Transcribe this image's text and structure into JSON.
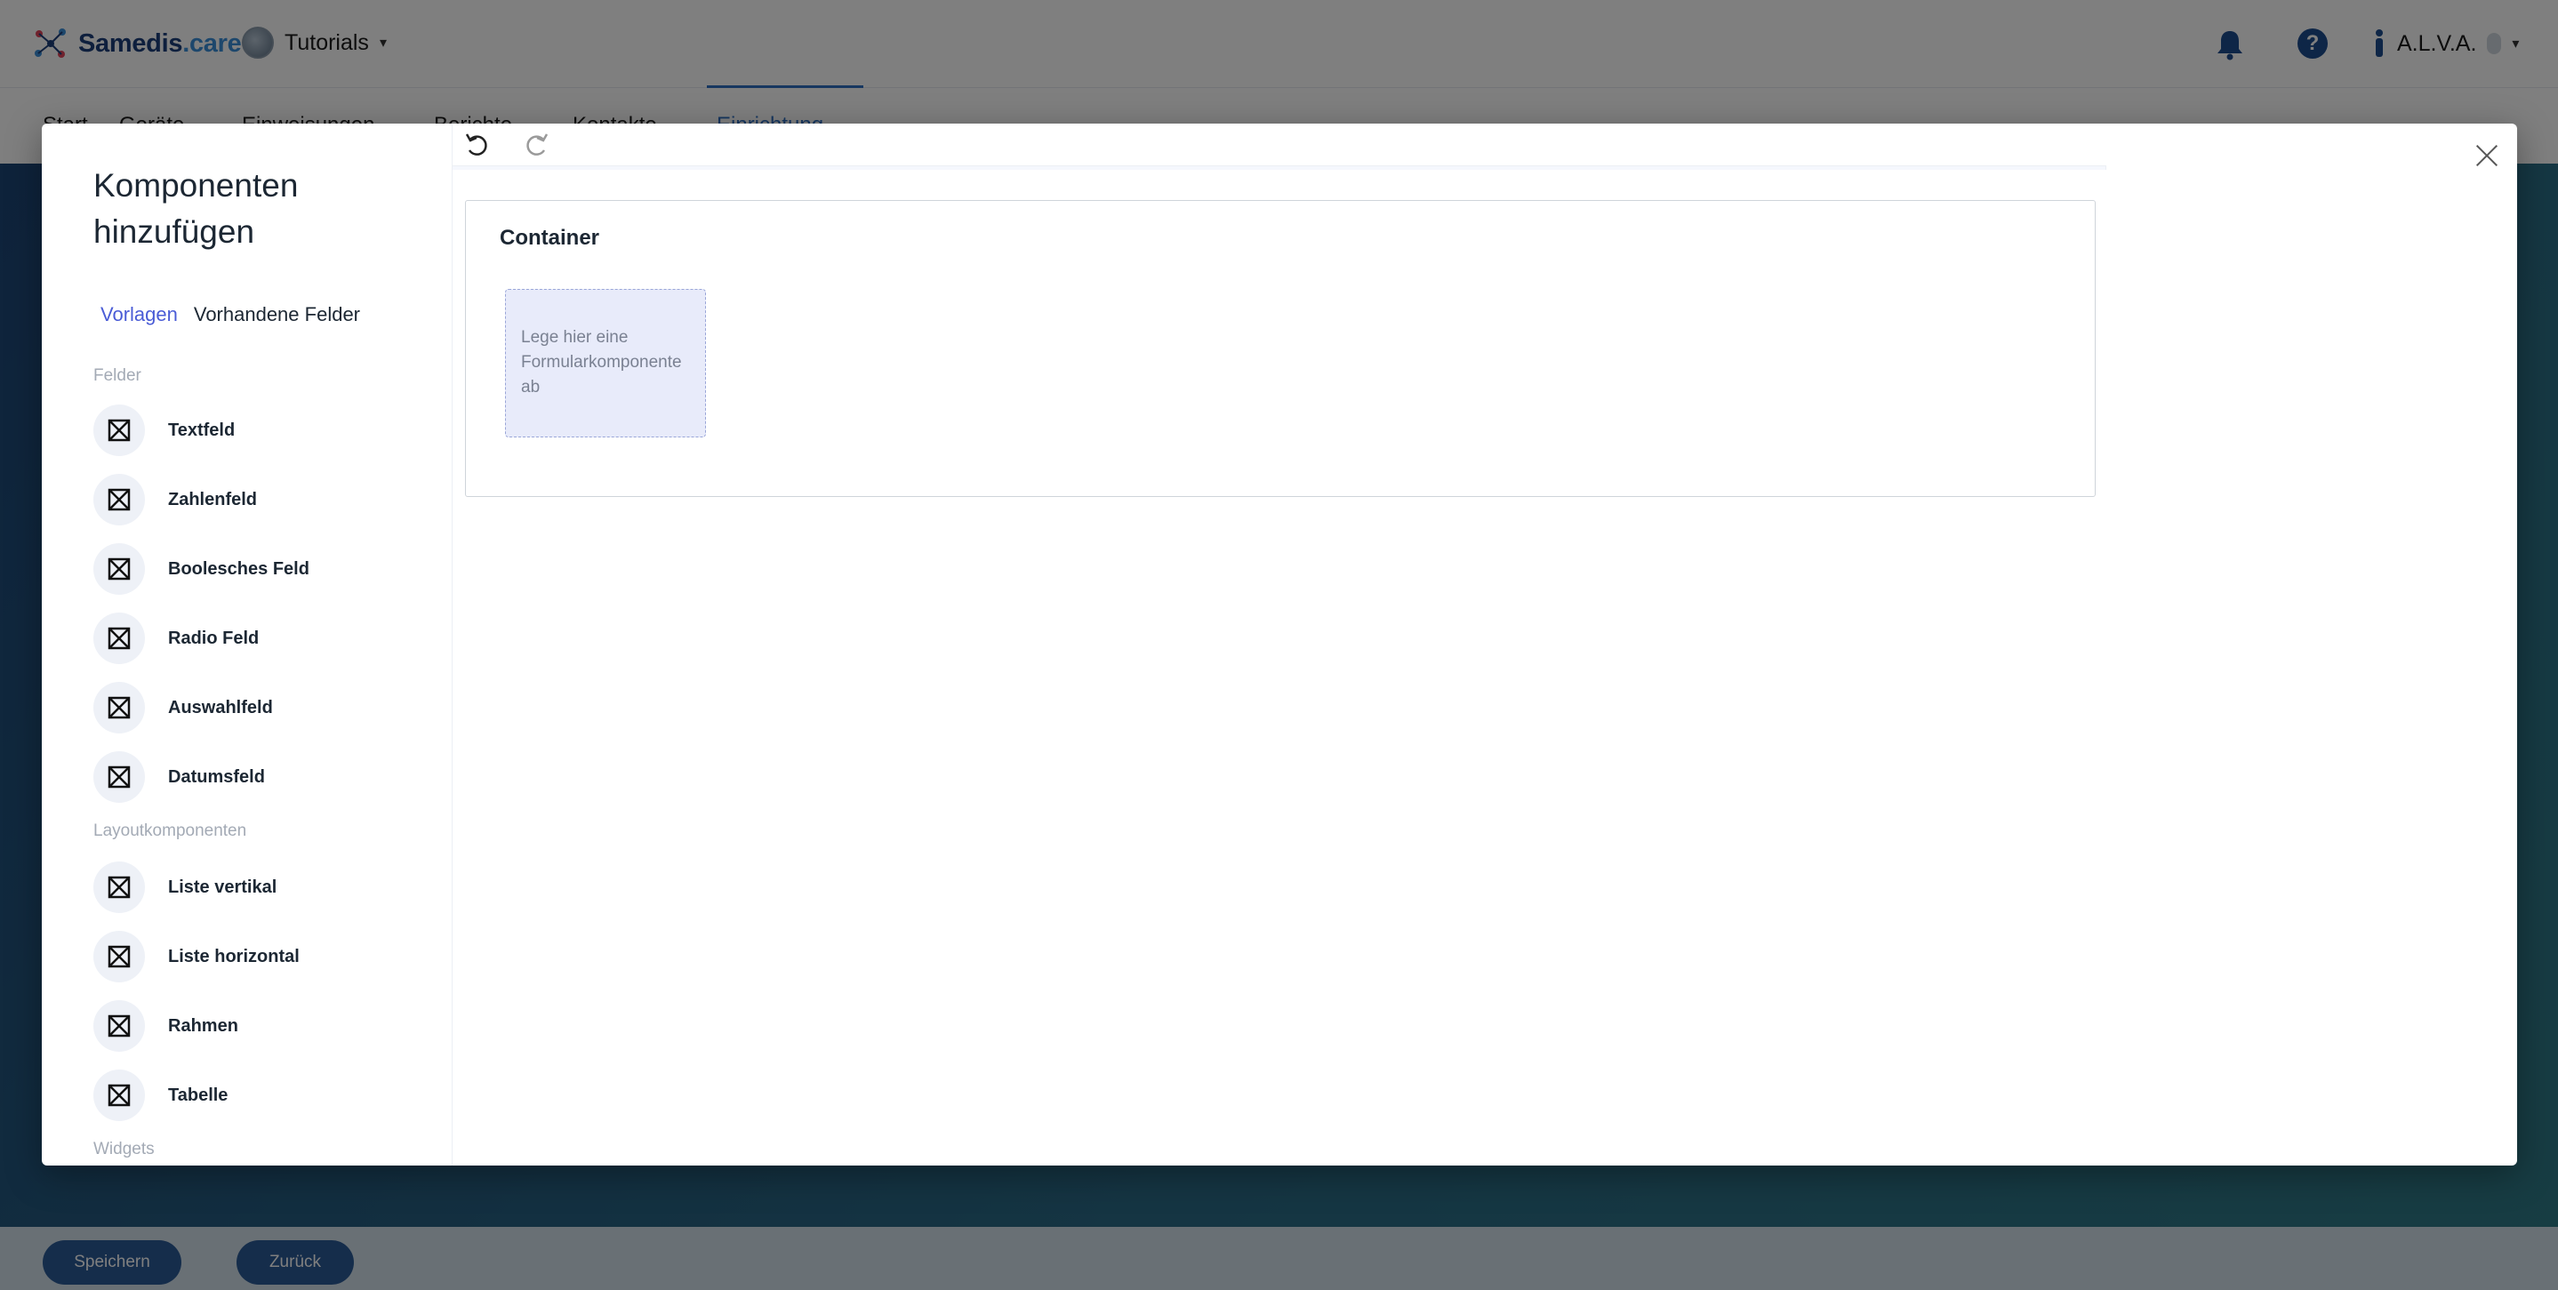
{
  "app": {
    "logo_main": "Samedis",
    "logo_suffix": ".care",
    "tenant": "Tutorials",
    "user": "A.L.V.A."
  },
  "nav_tabs": [
    "Start",
    "Geräte",
    "Einweisungen",
    "Berichte",
    "Kontakte",
    "Einrichtung"
  ],
  "footer": {
    "save_label": "Speichern",
    "back_label": "Zurück"
  },
  "modal": {
    "title": "Komponenten hinzufügen",
    "tabs": [
      "Vorlagen",
      "Vorhandene Felder"
    ],
    "groups": {
      "fields_label": "Felder",
      "fields": [
        "Textfeld",
        "Zahlenfeld",
        "Boolesches Feld",
        "Radio Feld",
        "Auswahlfeld",
        "Datumsfeld"
      ],
      "layout_label": "Layoutkomponenten",
      "layout": [
        "Liste vertikal",
        "Liste horizontal",
        "Rahmen",
        "Tabelle"
      ],
      "widgets_label": "Widgets"
    },
    "container_title": "Container",
    "dropzone_text": "Lege hier eine Formularkomponente ab"
  },
  "colors": {
    "accent": "#4a5cd6",
    "brand": "#1d3f7a",
    "dropzone": "#e8ebfa"
  }
}
